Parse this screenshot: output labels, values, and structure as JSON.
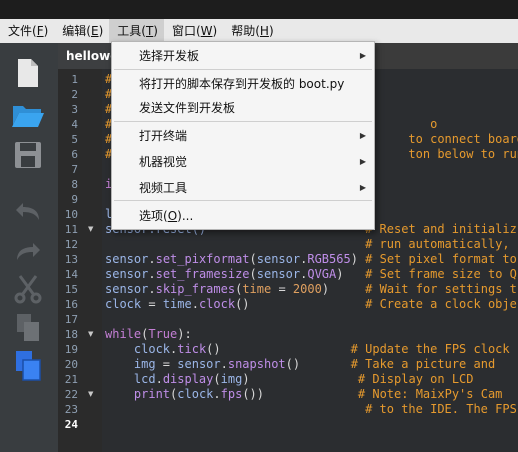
{
  "menubar": {
    "items": [
      {
        "label": "文件(",
        "key": "F",
        "end": ")"
      },
      {
        "label": "编辑(",
        "key": "E",
        "end": ")"
      },
      {
        "label": "工具(",
        "key": "T",
        "end": ")"
      },
      {
        "label": "窗口(",
        "key": "W",
        "end": ")"
      },
      {
        "label": "帮助(",
        "key": "H",
        "end": ")"
      }
    ]
  },
  "tab": {
    "label": "hellowo"
  },
  "toolbar": {
    "icons": [
      "new-file-icon",
      "open-folder-icon",
      "save-icon",
      "undo-icon",
      "redo-icon",
      "cut-icon",
      "copy-icon",
      "paste-icon"
    ]
  },
  "dropdown": {
    "items": [
      {
        "label": "选择开发板",
        "submenu": true
      },
      {
        "label": "将打开的脚本保存到开发板的 boot.py",
        "submenu": false
      },
      {
        "label": "发送文件到开发板",
        "submenu": false
      },
      {
        "label": "打开终端",
        "submenu": true
      },
      {
        "label": "机器视觉",
        "submenu": true
      },
      {
        "label": "视频工具",
        "submenu": true
      },
      {
        "label": "选项(",
        "key": "O",
        "end": ")...",
        "submenu": false
      }
    ]
  },
  "editor": {
    "line_numbers": [
      "1",
      "2",
      "3",
      "4",
      "5",
      "6",
      "7",
      "8",
      "9",
      "10",
      "11",
      "12",
      "13",
      "14",
      "15",
      "16",
      "17",
      "18",
      "19",
      "20",
      "21",
      "22",
      "23",
      "24"
    ],
    "current_line": "24",
    "lines": [
      {
        "segments": [
          {
            "t": "#",
            "c": "cm"
          }
        ]
      },
      {
        "segments": [
          {
            "t": "#",
            "c": "cm"
          }
        ]
      },
      {
        "segments": [
          {
            "t": "#",
            "c": "cm"
          }
        ]
      },
      {
        "segments": [
          {
            "t": "#                                            o",
            "c": "cm"
          }
        ]
      },
      {
        "segments": [
          {
            "t": "#                                         to connect board",
            "c": "cm"
          }
        ]
      },
      {
        "segments": [
          {
            "t": "#                                         ton below to run the",
            "c": "cm"
          }
        ]
      },
      {
        "segments": []
      },
      {
        "segments": [
          {
            "t": "i",
            "c": "kw"
          }
        ]
      },
      {
        "segments": []
      },
      {
        "segments": [
          {
            "t": "l",
            "c": "obj"
          }
        ]
      },
      {
        "segments": [
          {
            "t": "sensor.reset()",
            "c": "obj"
          },
          {
            "t": "                      # Reset and initializ",
            "c": "cm"
          }
        ]
      },
      {
        "segments": [
          {
            "t": "                                    # run automatically, ",
            "c": "cm"
          }
        ]
      },
      {
        "segments": [
          {
            "t": "sensor",
            "c": "obj"
          },
          {
            "t": ".",
            "c": ""
          },
          {
            "t": "set_pixformat",
            "c": "fn"
          },
          {
            "t": "(",
            "c": ""
          },
          {
            "t": "sensor",
            "c": "obj"
          },
          {
            "t": ".",
            "c": ""
          },
          {
            "t": "RGB565",
            "c": "fn"
          },
          {
            "t": ") ",
            "c": ""
          },
          {
            "t": "# Set pixel format to",
            "c": "cm"
          }
        ]
      },
      {
        "segments": [
          {
            "t": "sensor",
            "c": "obj"
          },
          {
            "t": ".",
            "c": ""
          },
          {
            "t": "set_framesize",
            "c": "fn"
          },
          {
            "t": "(",
            "c": ""
          },
          {
            "t": "sensor",
            "c": "obj"
          },
          {
            "t": ".",
            "c": ""
          },
          {
            "t": "QVGA",
            "c": "fn"
          },
          {
            "t": ")   ",
            "c": ""
          },
          {
            "t": "# Set frame size to Q",
            "c": "cm"
          }
        ]
      },
      {
        "segments": [
          {
            "t": "sensor",
            "c": "obj"
          },
          {
            "t": ".",
            "c": ""
          },
          {
            "t": "skip_frames",
            "c": "fn"
          },
          {
            "t": "(",
            "c": ""
          },
          {
            "t": "time",
            "c": "num"
          },
          {
            "t": " = ",
            "c": ""
          },
          {
            "t": "2000",
            "c": "num"
          },
          {
            "t": ")     ",
            "c": ""
          },
          {
            "t": "# Wait for settings t",
            "c": "cm"
          }
        ]
      },
      {
        "segments": [
          {
            "t": "clock",
            "c": "obj"
          },
          {
            "t": " = ",
            "c": ""
          },
          {
            "t": "time",
            "c": "obj"
          },
          {
            "t": ".",
            "c": ""
          },
          {
            "t": "clock",
            "c": "fn"
          },
          {
            "t": "()                ",
            "c": ""
          },
          {
            "t": "# Create a clock obje",
            "c": "cm"
          }
        ]
      },
      {
        "segments": []
      },
      {
        "segments": [
          {
            "t": "while",
            "c": "kw"
          },
          {
            "t": "(",
            "c": ""
          },
          {
            "t": "True",
            "c": "kw"
          },
          {
            "t": "):",
            "c": ""
          }
        ]
      },
      {
        "segments": [
          {
            "t": "    clock",
            "c": "obj"
          },
          {
            "t": ".",
            "c": ""
          },
          {
            "t": "tick",
            "c": "fn"
          },
          {
            "t": "()                  ",
            "c": ""
          },
          {
            "t": "# Update the FPS clock",
            "c": "cm"
          }
        ]
      },
      {
        "segments": [
          {
            "t": "    img",
            "c": "obj"
          },
          {
            "t": " = ",
            "c": ""
          },
          {
            "t": "sensor",
            "c": "obj"
          },
          {
            "t": ".",
            "c": ""
          },
          {
            "t": "snapshot",
            "c": "fn"
          },
          {
            "t": "()       ",
            "c": ""
          },
          {
            "t": "# Take a picture and ",
            "c": "cm"
          }
        ]
      },
      {
        "segments": [
          {
            "t": "    lcd",
            "c": "obj"
          },
          {
            "t": ".",
            "c": ""
          },
          {
            "t": "display",
            "c": "fn"
          },
          {
            "t": "(",
            "c": ""
          },
          {
            "t": "img",
            "c": "obj"
          },
          {
            "t": ")               ",
            "c": ""
          },
          {
            "t": "# Display on LCD",
            "c": "cm"
          }
        ]
      },
      {
        "segments": [
          {
            "t": "    print",
            "c": "fn"
          },
          {
            "t": "(",
            "c": ""
          },
          {
            "t": "clock",
            "c": "obj"
          },
          {
            "t": ".",
            "c": ""
          },
          {
            "t": "fps",
            "c": "fn"
          },
          {
            "t": "())             ",
            "c": ""
          },
          {
            "t": "# Note: MaixPy's Cam ",
            "c": "cm"
          }
        ]
      },
      {
        "segments": [
          {
            "t": "                                    # to the IDE. The FPS",
            "c": "cm"
          }
        ]
      },
      {
        "segments": []
      }
    ]
  },
  "colors": {
    "accent_icon": "#2f8fd6",
    "comment": "#e69a2e"
  }
}
